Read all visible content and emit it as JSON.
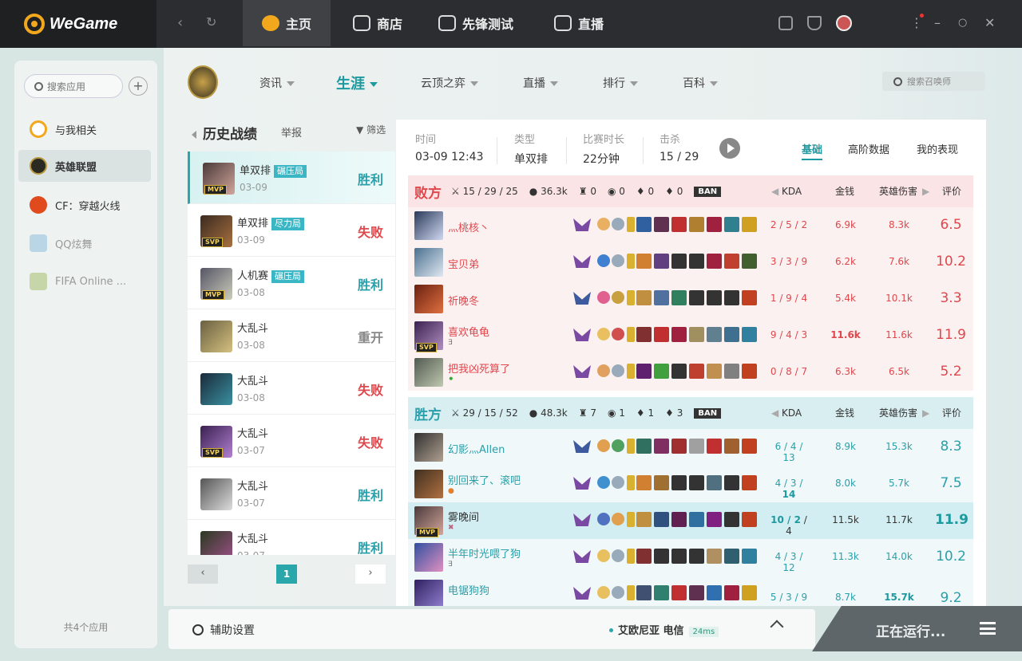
{
  "app": {
    "name": "WeGame"
  },
  "topnav": {
    "tabs": [
      {
        "label": "主页"
      },
      {
        "label": "商店"
      },
      {
        "label": "先锋测试"
      },
      {
        "label": "直播"
      }
    ]
  },
  "sidebar": {
    "search_placeholder": "搜索应用",
    "items": [
      {
        "label": "与我相关"
      },
      {
        "label": "英雄联盟"
      },
      {
        "label": "CF：穿越火线"
      },
      {
        "label": "QQ炫舞"
      },
      {
        "label": "FIFA Online ..."
      }
    ],
    "footer": "共4个应用"
  },
  "lolnav": {
    "items": [
      {
        "label": "资讯"
      },
      {
        "label": "生涯"
      },
      {
        "label": "云顶之弈"
      },
      {
        "label": "直播"
      },
      {
        "label": "排行"
      },
      {
        "label": "百科"
      }
    ],
    "search_placeholder": "搜索召唤师"
  },
  "history": {
    "title": "历史战绩",
    "report": "举报",
    "filter": "筛选",
    "matches": [
      {
        "mode": "单双排",
        "badge": "碾压局",
        "date": "03-09",
        "result": "胜利",
        "tag": "MVP"
      },
      {
        "mode": "单双排",
        "badge": "尽力局",
        "date": "03-09",
        "result": "失败",
        "tag": "SVP"
      },
      {
        "mode": "人机赛",
        "badge": "碾压局",
        "date": "03-08",
        "result": "胜利",
        "tag": "MVP"
      },
      {
        "mode": "大乱斗",
        "badge": "",
        "date": "03-08",
        "result": "重开",
        "tag": ""
      },
      {
        "mode": "大乱斗",
        "badge": "",
        "date": "03-08",
        "result": "失败",
        "tag": ""
      },
      {
        "mode": "大乱斗",
        "badge": "",
        "date": "03-07",
        "result": "失败",
        "tag": "SVP"
      },
      {
        "mode": "大乱斗",
        "badge": "",
        "date": "03-07",
        "result": "胜利",
        "tag": ""
      },
      {
        "mode": "大乱斗",
        "badge": "",
        "date": "03-07",
        "result": "胜利",
        "tag": ""
      }
    ],
    "page": "1"
  },
  "detail": {
    "time_label": "时间",
    "time": "03-09 12:43",
    "type_label": "类型",
    "type": "单双排",
    "duration_label": "比赛时长",
    "duration": "22分钟",
    "kills_label": "击杀",
    "kills": "15 / 29",
    "tabs": [
      "基础",
      "高阶数据",
      "我的表现"
    ],
    "cols": {
      "kda": "KDA",
      "gold": "金钱",
      "dmg": "英雄伤害",
      "score": "评价"
    },
    "lose_team": {
      "name": "败方",
      "kda": "15 / 29 / 25",
      "gold": "36.3k",
      "towers": "0",
      "inhibs": "0",
      "barons": "0",
      "dragons": "0",
      "ban": "BAN",
      "players": [
        {
          "name": "灬桃核丶",
          "sub": "",
          "tag": "",
          "kda": "2 / 5 / 2",
          "gold": "6.9k",
          "dmg": "8.3k",
          "score": "6.5"
        },
        {
          "name": "宝贝弟",
          "sub": "",
          "tag": "",
          "kda": "3 / 3 / 9",
          "gold": "6.2k",
          "dmg": "7.6k",
          "score": "10.2"
        },
        {
          "name": "祈晚冬",
          "sub": "",
          "tag": "",
          "kda": "1 / 9 / 4",
          "gold": "5.4k",
          "dmg": "10.1k",
          "score": "3.3"
        },
        {
          "name": "喜欢龟龟",
          "sub": "∃",
          "tag": "SVP",
          "kda": "9 / 4 / 3",
          "gold": "11.6k",
          "dmg": "11.6k",
          "score": "11.9"
        },
        {
          "name": "把我凶死算了",
          "sub": "",
          "tag": "",
          "kda": "0 / 8 / 7",
          "gold": "6.3k",
          "dmg": "6.5k",
          "score": "5.2"
        }
      ]
    },
    "win_team": {
      "name": "胜方",
      "kda": "29 / 15 / 52",
      "gold": "48.3k",
      "towers": "7",
      "inhibs": "1",
      "barons": "1",
      "dragons": "3",
      "ban": "BAN",
      "players": [
        {
          "name": "幻影灬Allen",
          "sub": "",
          "tag": "",
          "kda": "6 / 4 / 13",
          "gold": "8.9k",
          "dmg": "15.3k",
          "score": "8.3"
        },
        {
          "name": "别回来了、滚吧",
          "sub": "",
          "tag": "",
          "kda_a": "4 / 3 / ",
          "kda_b": "14",
          "gold": "8.0k",
          "dmg": "5.7k",
          "score": "7.5"
        },
        {
          "name": "雾晚间",
          "sub": "",
          "tag": "MVP",
          "kda_a": "10 / 2",
          "kda_b": " / 4",
          "gold": "11.5k",
          "dmg": "11.7k",
          "score": "11.9"
        },
        {
          "name": "半年时光喂了狗",
          "sub": "∃",
          "tag": "",
          "kda": "4 / 3 / 12",
          "gold": "11.3k",
          "dmg": "14.0k",
          "score": "10.2"
        },
        {
          "name": "电锯狗狗",
          "sub": "",
          "tag": "",
          "kda": "5 / 3 / 9",
          "gold": "8.7k",
          "dmg": "15.7k",
          "score": "9.2"
        }
      ]
    }
  },
  "bottom": {
    "settings": "辅助设置",
    "server": "艾欧尼亚 电信",
    "ping": "24ms",
    "running": "正在运行..."
  }
}
